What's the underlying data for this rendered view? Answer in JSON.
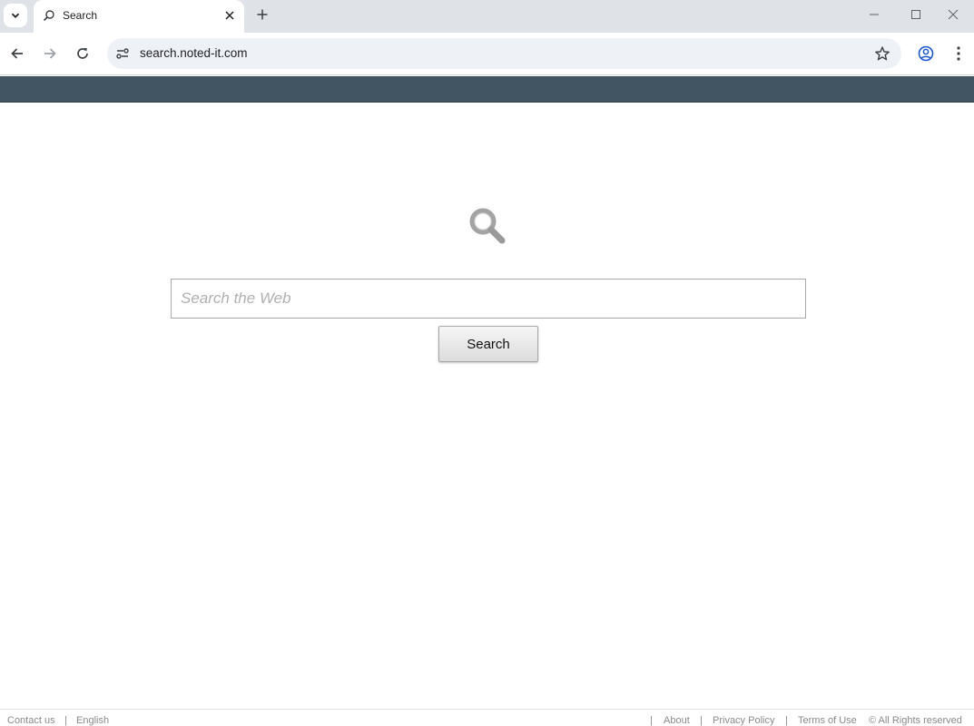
{
  "browser": {
    "tab": {
      "title": "Search"
    },
    "address": {
      "url": "search.noted-it.com"
    }
  },
  "icons": {
    "tab_search": "chevron-down-icon",
    "favicon": "search-icon",
    "close": "close-icon",
    "new_tab": "plus-icon",
    "back": "arrow-left-icon",
    "forward": "arrow-right-icon",
    "reload": "reload-icon",
    "site_info": "tune-icon",
    "bookmark": "star-icon",
    "profile": "account-icon",
    "menu": "kebab-menu-icon",
    "logo": "magnifier-icon"
  },
  "colors": {
    "site_bar": "#425563",
    "tab_strip": "#dfe3e8"
  },
  "page": {
    "search": {
      "placeholder": "Search the Web",
      "value": "",
      "button_label": "Search"
    }
  },
  "footer": {
    "contact": "Contact us",
    "language": "English",
    "about": "About",
    "privacy": "Privacy Policy",
    "terms": "Terms of Use",
    "copyright": "© All Rights reserved",
    "separator": "|"
  }
}
